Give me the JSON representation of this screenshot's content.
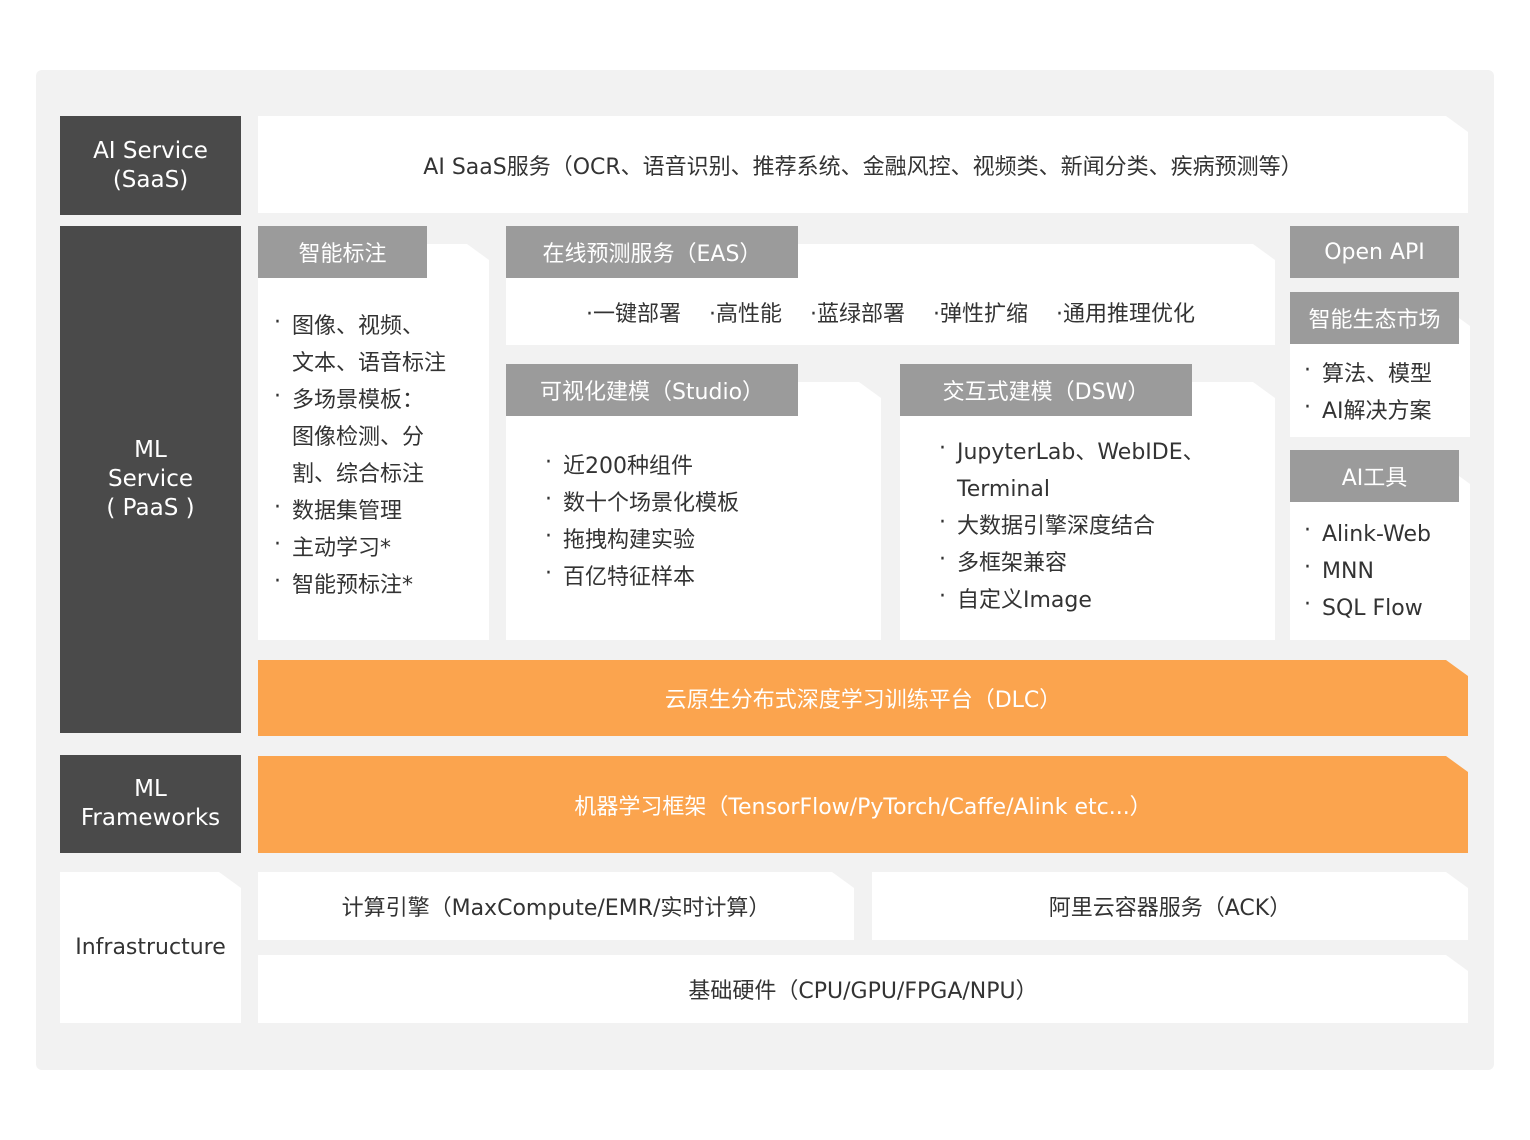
{
  "layers": {
    "ai_service": "AI Service\n(SaaS)",
    "ml_service": "ML\nService\n( PaaS )",
    "ml_frameworks": "ML\nFrameworks",
    "infrastructure": "Infrastructure"
  },
  "saas_bar": "AI SaaS服务（OCR、语音识别、推荐系统、金融风控、视频类、新闻分类、疾病预测等）",
  "smart_label": {
    "title": "智能标注",
    "items": [
      "图像、视频、\n文本、语音标注",
      "多场景模板：\n图像检测、分\n割、综合标注",
      "数据集管理",
      "主动学习*",
      "智能预标注*"
    ]
  },
  "eas": {
    "title": "在线预测服务（EAS）",
    "items": [
      "·一键部署",
      "·高性能",
      "·蓝绿部署",
      "·弹性扩缩",
      "·通用推理优化"
    ]
  },
  "studio": {
    "title": "可视化建模（Studio）",
    "items": [
      "近200种组件",
      "数十个场景化模板",
      "拖拽构建实验",
      "百亿特征样本"
    ]
  },
  "dsw": {
    "title": "交互式建模（DSW）",
    "items": [
      "JupyterLab、WebIDE、\nTerminal",
      "大数据引擎深度结合",
      "多框架兼容",
      "自定义Image"
    ]
  },
  "open_api": "Open API",
  "eco_market": {
    "title": "智能生态市场",
    "items": [
      "算法、模型",
      "AI解决方案"
    ]
  },
  "ai_tools": {
    "title": "AI工具",
    "items": [
      "Alink-Web",
      "MNN",
      "SQL Flow"
    ]
  },
  "dlc_bar": "云原生分布式深度学习训练平台（DLC）",
  "framework_bar": "机器学习框架（TensorFlow/PyTorch/Caffe/Alink etc...）",
  "compute_bar": "计算引擎（MaxCompute/EMR/实时计算）",
  "ack_bar": "阿里云容器服务（ACK）",
  "hardware_bar": "基础硬件（CPU/GPU/FPGA/NPU）",
  "colors": {
    "dark": "#4a4a4a",
    "tab": "#9b9b9b",
    "orange": "#fba44e",
    "frame": "#f2f2f2"
  }
}
